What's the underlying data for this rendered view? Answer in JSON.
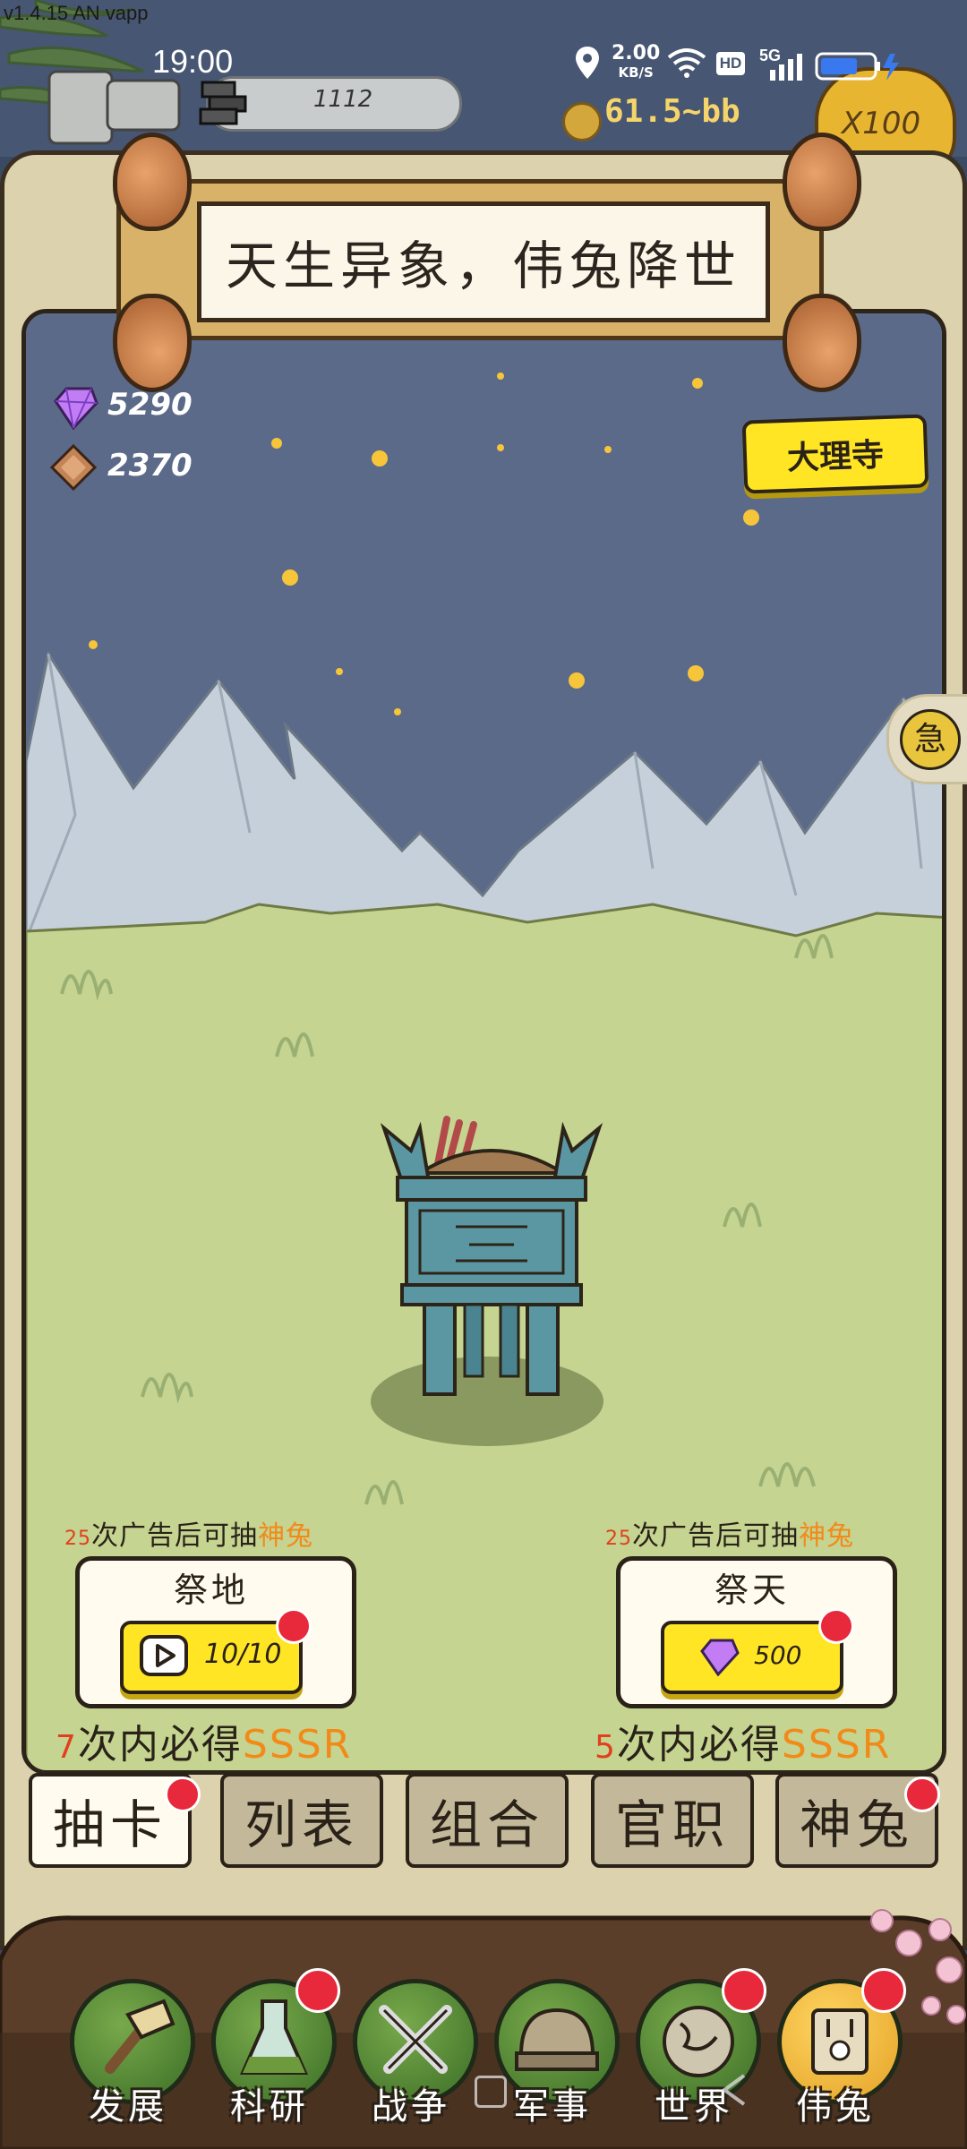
{
  "status_bar": {
    "version": "v1.4.15 AN vapp",
    "time": "19:00",
    "net_speed_value": "2.00",
    "net_speed_unit": "KB/S",
    "hd": "HD",
    "signal": "5G"
  },
  "top": {
    "pill_value": "1112",
    "coins": "61.5~bb",
    "multiplier": "X100"
  },
  "banner": {
    "title": "天生异象，伟兔降世"
  },
  "resources": {
    "gems": "5290",
    "ore": "2370"
  },
  "temple_button": "大理寺",
  "side_button": "急",
  "gacha": {
    "left": {
      "hint_count": "25",
      "hint_text": "次广告后可抽",
      "hint_highlight": "神兔",
      "title": "祭地",
      "cost": "10/10",
      "guarantee_count": "7",
      "guarantee_text": "次内必得",
      "guarantee_rank": "SSSR"
    },
    "right": {
      "hint_count": "25",
      "hint_text": "次广告后可抽",
      "hint_highlight": "神兔",
      "title": "祭天",
      "cost": "500",
      "guarantee_count": "5",
      "guarantee_text": "次内必得",
      "guarantee_rank": "SSSR"
    }
  },
  "tabs": [
    "抽卡",
    "列表",
    "组合",
    "官职",
    "神兔"
  ],
  "active_tab": "抽卡",
  "nav": [
    "发展",
    "科研",
    "战争",
    "军事",
    "世界",
    "伟兔"
  ],
  "active_nav": "伟兔",
  "colors": {
    "accent_yellow": "#ffe524",
    "badge_red": "#e8283b",
    "highlight_orange": "#f28a1a"
  }
}
